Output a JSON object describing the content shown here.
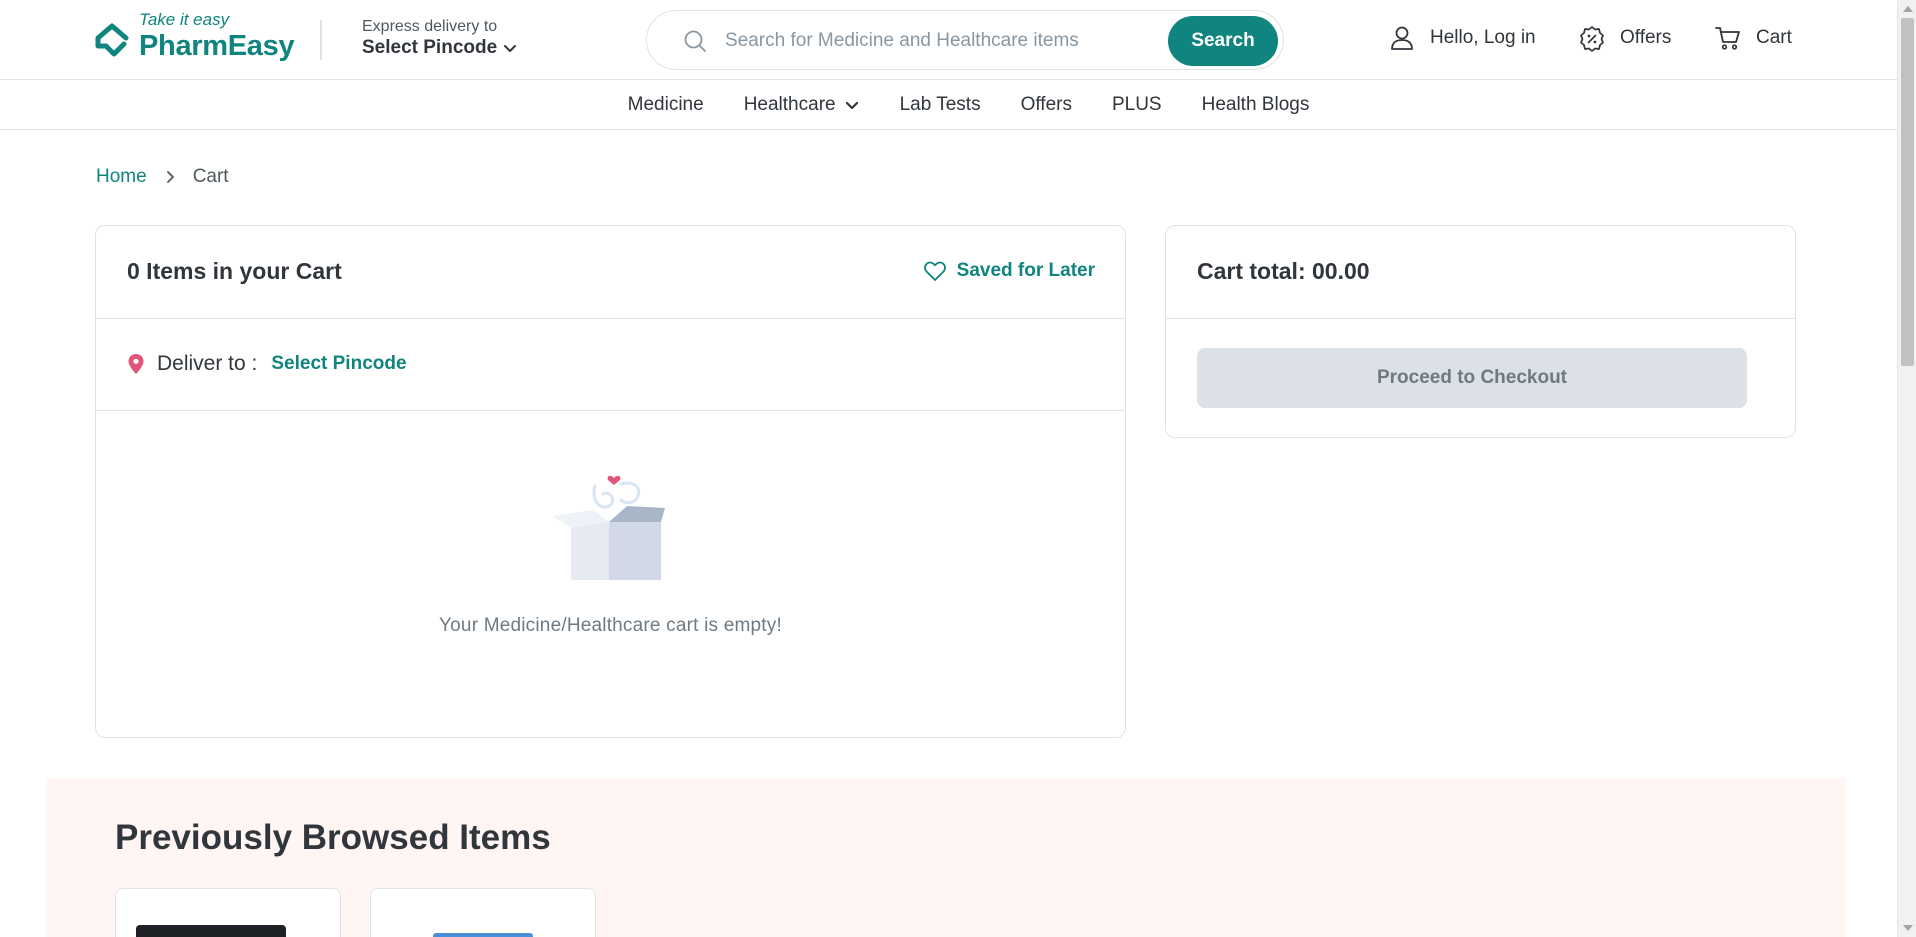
{
  "brand": {
    "tagline": "Take it easy",
    "name": "PharmEasy",
    "accent": "#10847e"
  },
  "delivery": {
    "label": "Express delivery to",
    "pincode": "Select Pincode"
  },
  "search": {
    "placeholder": "Search for Medicine and Healthcare items",
    "button": "Search"
  },
  "header_actions": {
    "login": "Hello, Log in",
    "offers": "Offers",
    "cart": "Cart"
  },
  "nav": [
    "Medicine",
    "Healthcare",
    "Lab Tests",
    "Offers",
    "PLUS",
    "Health Blogs"
  ],
  "breadcrumb": {
    "home": "Home",
    "current": "Cart"
  },
  "cart": {
    "title": "0 Items in your Cart",
    "saved_for_later": "Saved for Later",
    "deliver_label": "Deliver to :",
    "deliver_pincode": "Select Pincode",
    "empty_message": "Your Medicine/Healthcare cart is empty!"
  },
  "total": {
    "label": "Cart total:",
    "amount": "00.00",
    "checkout": "Proceed to Checkout"
  },
  "browsed": {
    "title": "Previously Browsed Items"
  },
  "icons": {
    "logo": "pharmeasy-logo-icon",
    "search": "search-icon",
    "user": "user-icon",
    "offers": "offer-badge-icon",
    "cart": "cart-icon",
    "heart": "heart-icon",
    "pin": "location-pin-icon",
    "chevron": "chevron-down-icon",
    "empty_box": "empty-box-illustration"
  }
}
